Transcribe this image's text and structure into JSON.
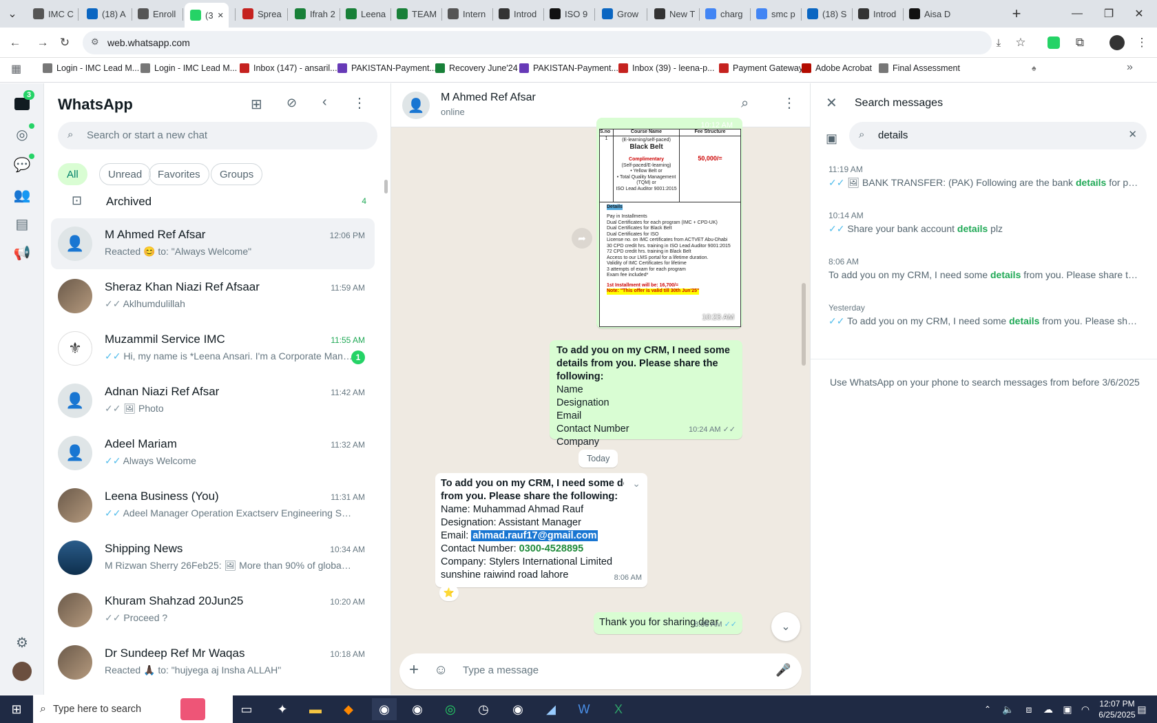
{
  "browser": {
    "tabs": [
      {
        "title": "IMC C",
        "color": "#555"
      },
      {
        "title": "(18) A",
        "color": "#0a66c2"
      },
      {
        "title": "Enroll",
        "color": "#555"
      },
      {
        "title": "(3",
        "color": "#25d366"
      },
      {
        "title": "Sprea",
        "color": "#c5221f"
      },
      {
        "title": "Ifrah 2",
        "color": "#188038"
      },
      {
        "title": "Leena",
        "color": "#188038"
      },
      {
        "title": "TEAM",
        "color": "#188038"
      },
      {
        "title": "Intern",
        "color": "#555"
      },
      {
        "title": "Introd",
        "color": "#333"
      },
      {
        "title": "ISO 9",
        "color": "#111"
      },
      {
        "title": "Grow",
        "color": "#0a66c2"
      },
      {
        "title": "New T",
        "color": "#333"
      },
      {
        "title": "charg",
        "color": "#4285f4"
      },
      {
        "title": "smc p",
        "color": "#4285f4"
      },
      {
        "title": "(18) S",
        "color": "#0a66c2"
      },
      {
        "title": "Introd",
        "color": "#333"
      },
      {
        "title": "Aisa D",
        "color": "#111"
      }
    ],
    "url": "web.whatsapp.com",
    "bookmarks": [
      {
        "label": "Login - IMC Lead M...",
        "color": "#777"
      },
      {
        "label": "Login - IMC Lead M...",
        "color": "#777"
      },
      {
        "label": "Inbox (147) - ansaril...",
        "color": "#c5221f"
      },
      {
        "label": "PAKISTAN-Payment...",
        "color": "#673ab7"
      },
      {
        "label": "Recovery June'24",
        "color": "#188038"
      },
      {
        "label": "PAKISTAN-Payment...",
        "color": "#673ab7"
      },
      {
        "label": "Inbox (39) - leena-p...",
        "color": "#c5221f"
      },
      {
        "label": "Payment Gateway",
        "color": "#c5221f"
      },
      {
        "label": "Adobe Acrobat",
        "color": "#b30b00"
      },
      {
        "label": "Final Assessment",
        "color": "#777"
      }
    ]
  },
  "rail": {
    "badge": "3"
  },
  "chatlist": {
    "title": "WhatsApp",
    "search_placeholder": "Search or start a new chat",
    "filters": [
      "All",
      "Unread",
      "Favorites",
      "Groups"
    ],
    "archived": {
      "label": "Archived",
      "count": "4"
    },
    "chats": [
      {
        "name": "M Ahmed Ref Afsar",
        "time": "12:06 PM",
        "preview": "Reacted 😊 to: \"Always Welcome\"",
        "tick": "",
        "unread": "",
        "avatar": "default"
      },
      {
        "name": "Sheraz Khan Niazi Ref Afsaar",
        "time": "11:59 AM",
        "preview": "Aklhumdulillah",
        "tick": "✓✓",
        "unread": "",
        "avatar": "photo"
      },
      {
        "name": "Muzammil Service IMC",
        "time": "11:55 AM",
        "preview": "Hi, my name is *Leena Ansari. I'm a Corporate Mana...",
        "tick": "✓✓",
        "unread": "1",
        "avatar": "logo"
      },
      {
        "name": "Adnan Niazi Ref Afsar",
        "time": "11:42 AM",
        "preview": "🖼 Photo",
        "tick": "✓✓",
        "unread": "",
        "avatar": "default"
      },
      {
        "name": "Adeel Mariam",
        "time": "11:32 AM",
        "preview": "Always Welcome",
        "tick": "✓✓",
        "unread": "",
        "avatar": "default"
      },
      {
        "name": "Leena Business (You)",
        "time": "11:31 AM",
        "preview": "Adeel Manager Operation Exactserv Engineering Servic...",
        "tick": "✓✓",
        "unread": "",
        "avatar": "photo"
      },
      {
        "name": "Shipping News",
        "time": "10:34 AM",
        "preview": "M Rizwan Sherry 26Feb25: 🖼 More than 90% of global tra...",
        "tick": "",
        "unread": "",
        "avatar": "ship"
      },
      {
        "name": "Khuram Shahzad 20Jun25",
        "time": "10:20 AM",
        "preview": "Proceed ?",
        "tick": "✓✓",
        "unread": "",
        "avatar": "photo"
      },
      {
        "name": "Dr Sundeep Ref Mr Waqas",
        "time": "10:18 AM",
        "preview": "Reacted 🙏🏿 to: \"hujyega aj Insha ALLAH\"",
        "tick": "",
        "unread": "",
        "avatar": "photo"
      }
    ]
  },
  "conversation": {
    "contact_name": "M Ahmed Ref Afsar",
    "status": "online",
    "image_msg": {
      "top_time": "10:12 AM",
      "time": "10:23 AM",
      "doc_header": [
        "S.no",
        "Course Name",
        "Fee Structure"
      ],
      "doc_lines": [
        "(E-learning/self-paced)",
        "Black Belt",
        "Complimentary",
        "(Self-paced/E-learning)",
        "• Yellow Belt or",
        "• Total Quality Management (TQM) or",
        "ISO Lead Auditor 9001:2015"
      ],
      "doc_fee": "50,000/=",
      "doc_details_title": "Details",
      "doc_bullets": [
        "Pay in Installments",
        "Dual Certificates for each program (IMC + CPD-UK)",
        "Dual Certificates for Black Belt",
        "Dual Certificates for ISO",
        "License no. on IMC certificates from ACTVET Abu-Dhabi",
        "30 CPD credit hrs. training in ISO Lead Auditor 9001:2015",
        "72 CPD credit hrs. training in Black Belt",
        "Access to our LMS portal for a lifetime duration.",
        "Validity of IMC Certificates for lifetime",
        "3 attempts of exam for each program",
        "Exam fee included*"
      ],
      "doc_installment": "1st Installment will be: 16,700/=",
      "doc_note": "Note: \"This offer is valid till 30th Jun'25\""
    },
    "crm_msg": {
      "bold": "To add you on my CRM, I need some details from you. Please share the following:",
      "lines": [
        "Name",
        "Designation",
        "Email",
        "Contact Number",
        "Company"
      ],
      "time": "10:24 AM"
    },
    "date_divider": "Today",
    "reply_msg": {
      "bold_line1": "To add you on my CRM, I need some de",
      "bold_line2": "from you. Please share the following:",
      "name": "Name: Muhammad Ahmad Rauf",
      "designation": "Designation: Assistant Manager",
      "email_label": "Email: ",
      "email": "ahmad.rauf17@gmail.com",
      "contact_label": "Contact Number: ",
      "contact": "0300-4528895",
      "company": "Company: Stylers International Limited",
      "address": "sunshine raiwind road lahore",
      "time": "8:06 AM",
      "reaction": "⭐"
    },
    "thanks_msg": {
      "text": "Thank you for sharing dear",
      "time": "8:08 AM"
    },
    "composer_placeholder": "Type a message"
  },
  "search_panel": {
    "title": "Search messages",
    "query": "details",
    "results": [
      {
        "date": "11:19 AM",
        "tick": "✓✓",
        "pre": "🖼 BANK TRANSFER: (PAK) Following are the bank ",
        "hit": "details",
        "post": " for paym..."
      },
      {
        "date": "10:14 AM",
        "tick": "✓✓",
        "pre": "Share your bank account ",
        "hit": "details",
        "post": " plz"
      },
      {
        "date": "8:06 AM",
        "tick": "",
        "pre": "To add you on my CRM, I need some ",
        "hit": "details",
        "post": " from you. Please share the..."
      },
      {
        "date": "Yesterday",
        "tick": "✓✓",
        "pre": "To add you on my CRM, I need some ",
        "hit": "details",
        "post": " from you. Please share ..."
      }
    ],
    "footer": "Use WhatsApp on your phone to search messages from before 3/6/2025"
  },
  "taskbar": {
    "search_placeholder": "Type here to search",
    "time": "12:07 PM",
    "date": "6/25/2025"
  }
}
